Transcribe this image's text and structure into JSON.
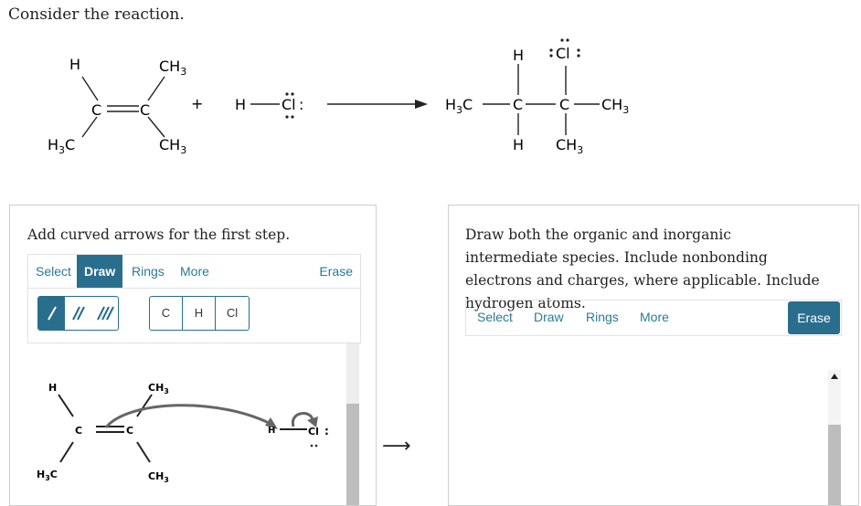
{
  "intro_text": "Consider the reaction.",
  "reaction": {
    "reactant1": {
      "h_left": "H",
      "ch3_top": "CH",
      "sub3": "3",
      "c_left": "C",
      "c_right": "C",
      "h3c": "H",
      "h3c_sub": "3",
      "h3c_c": "C",
      "ch3_bottom": "CH",
      "sub3b": "3"
    },
    "plus": "+",
    "hcl": {
      "h": "H",
      "cl": "Cl",
      "colon": ":"
    },
    "product": {
      "h3c": "H",
      "h3c_sub": "3",
      "h3c_c": "C",
      "c1": "C",
      "c2": "C",
      "h_top": "H",
      "cl": "Cl",
      "h_bottom": "H",
      "ch3_right": "CH",
      "sub_r": "3",
      "ch3_bottom": "CH",
      "sub_b": "3"
    }
  },
  "left_panel": {
    "instruction": "Add curved arrows for the first step.",
    "toolbar": {
      "select": "Select",
      "draw": "Draw",
      "rings": "Rings",
      "more": "More",
      "erase": "Erase"
    },
    "atoms": [
      "C",
      "H",
      "Cl"
    ],
    "canvas": {
      "h_left": "H",
      "c_left": "C",
      "c_right": "C",
      "ch3_top": "CH",
      "sub3_top": "3",
      "h3c": "H",
      "h3c_sub": "3",
      "h3c_c": "C",
      "ch3_bottom": "CH",
      "sub3_bottom": "3",
      "h_hcl": "H",
      "cl": "Cl",
      "colon": ":"
    }
  },
  "arrow_between": "⟶",
  "right_panel": {
    "instruction": "Draw both the organic and inorganic intermediate species. Include nonbonding electrons and charges, where applicable. Include hydrogen atoms.",
    "toolbar": {
      "select": "Select",
      "draw": "Draw",
      "rings": "Rings",
      "more": "More",
      "erase": "Erase"
    }
  },
  "colors": {
    "accent": "#2a6e8e",
    "link": "#2a7a96",
    "panel_border": "#cfcfcf"
  }
}
